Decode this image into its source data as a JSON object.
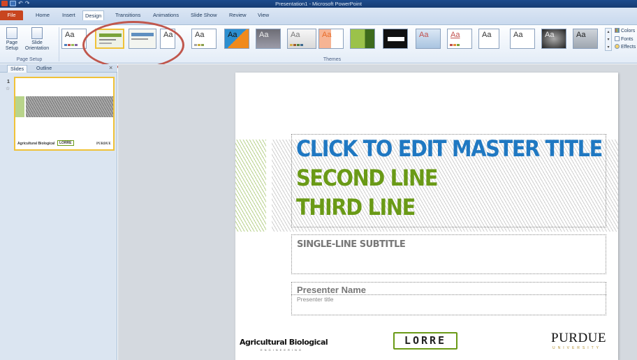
{
  "window": {
    "title": "Presentation1 - Microsoft PowerPoint"
  },
  "tabs": [
    {
      "label": "File"
    },
    {
      "label": "Home"
    },
    {
      "label": "Insert"
    },
    {
      "label": "Design"
    },
    {
      "label": "Transitions"
    },
    {
      "label": "Animations"
    },
    {
      "label": "Slide Show"
    },
    {
      "label": "Review"
    },
    {
      "label": "View"
    }
  ],
  "ribbon": {
    "page_setup": {
      "page_setup_label": "Page Setup",
      "orientation_label": "Slide Orientation",
      "group_label": "Page Setup"
    },
    "themes": {
      "group_label": "Themes",
      "theme_glyph": "Aa"
    },
    "theme_options": {
      "colors": "Colors",
      "fonts": "Fonts",
      "effects": "Effects"
    }
  },
  "pane": {
    "tabs": [
      "Slides",
      "Outline"
    ],
    "close": "×",
    "slide_number": "1",
    "thumb_logos": {
      "ag": "Agricultural Biological",
      "lorre": "LORRE",
      "purdue": "PURDUE"
    }
  },
  "slide": {
    "title_line1": "CLICK TO EDIT MASTER TITLE",
    "title_line2": "SECOND LINE",
    "title_line3": "THIRD LINE",
    "subtitle": "SINGLE-LINE SUBTITLE",
    "presenter_name": "Presenter Name",
    "presenter_title": "Presenter title",
    "logos": {
      "ag": "Agricultural Biological",
      "ag_sub": "ENGINEERING",
      "lorre": "LORRE",
      "purdue": "PURDUE",
      "purdue_sub": "UNIVERSITY"
    }
  },
  "colors": {
    "title_blue": "#1f78c2",
    "title_green": "#6a9a16",
    "file_tab": "#c8451f",
    "annotation": "#c0574d",
    "selected_theme": "#f0c238"
  }
}
